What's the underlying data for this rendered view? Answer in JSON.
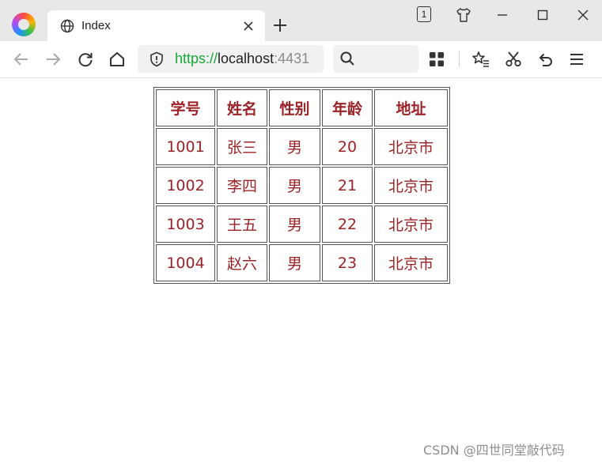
{
  "browser": {
    "tab_title": "Index",
    "tab_count": "1"
  },
  "address": {
    "scheme": "https://",
    "host": "localhost",
    "port": ":4431"
  },
  "search": {
    "placeholder": ""
  },
  "table": {
    "headers": [
      "学号",
      "姓名",
      "性别",
      "年龄",
      "地址"
    ],
    "rows": [
      [
        "1001",
        "张三",
        "男",
        "20",
        "北京市"
      ],
      [
        "1002",
        "李四",
        "男",
        "21",
        "北京市"
      ],
      [
        "1003",
        "王五",
        "男",
        "22",
        "北京市"
      ],
      [
        "1004",
        "赵六",
        "男",
        "23",
        "北京市"
      ]
    ]
  },
  "watermark": "CSDN @四世同堂敲代码",
  "colors": {
    "table_text": "#9b2226",
    "url_scheme": "#18a63b",
    "tabstrip_bg": "#e8e8e8"
  }
}
